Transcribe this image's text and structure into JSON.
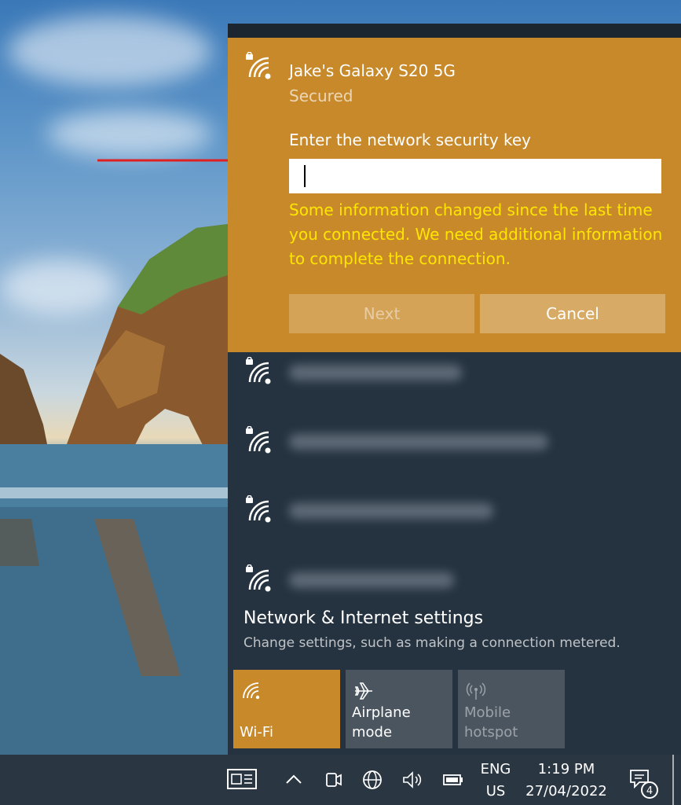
{
  "connect": {
    "network_name": "Jake's Galaxy S20 5G",
    "status": "Secured",
    "key_label": "Enter the network security key",
    "key_value": "",
    "warning": "Some information changed since the last time you connected. We need additional information to complete the connection.",
    "next_label": "Next",
    "cancel_label": "Cancel"
  },
  "networks": [
    {
      "name": "",
      "icon": "wifi-secured-icon"
    },
    {
      "name": "",
      "icon": "wifi-secured-icon"
    },
    {
      "name": "",
      "icon": "wifi-secured-icon"
    },
    {
      "name": "",
      "icon": "wifi-secured-icon"
    }
  ],
  "settings": {
    "title": "Network & Internet settings",
    "subtitle": "Change settings, such as making a connection metered."
  },
  "quick_actions": [
    {
      "label": "Wi-Fi",
      "icon": "wifi-icon",
      "state": "on"
    },
    {
      "label": "Airplane mode",
      "icon": "airplane-icon",
      "state": "off"
    },
    {
      "label": "Mobile hotspot",
      "icon": "hotspot-icon",
      "state": "disabled"
    }
  ],
  "taskbar": {
    "language": "ENG",
    "region": "US",
    "time": "1:19 PM",
    "date": "27/04/2022",
    "notification_count": "4"
  },
  "colors": {
    "accent": "#c8892a",
    "warning_text": "#ffe600",
    "flyout_bg": "#253340",
    "taskbar_bg": "#2a3642",
    "annotation_arrow": "#e02020"
  }
}
